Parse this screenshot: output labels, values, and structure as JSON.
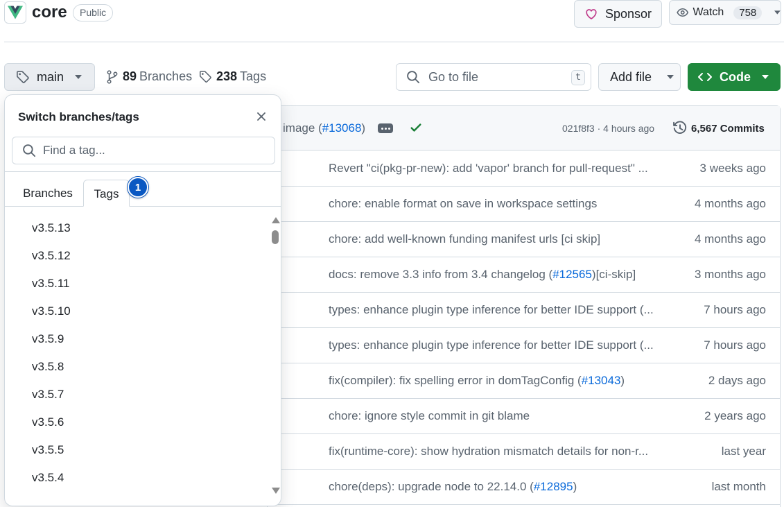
{
  "repo": {
    "name": "core",
    "visibility": "Public"
  },
  "header": {
    "sponsor_label": "Sponsor",
    "watch_label": "Watch",
    "watch_count": "758"
  },
  "toolbar": {
    "branch": "main",
    "branches_count": "89",
    "branches_label": "Branches",
    "tags_count": "238",
    "tags_label": "Tags",
    "go_to_file_placeholder": "Go to file",
    "go_to_file_key": "t",
    "add_file_label": "Add file",
    "code_label": "Code"
  },
  "latest_commit": {
    "message_prefix": "image (",
    "message_link": "#13068",
    "message_suffix": ")",
    "sha_time": "021f8f3 · 4 hours ago",
    "commits_label": "6,567 Commits"
  },
  "files": [
    {
      "msg": "Revert \"ci(pkg-pr-new): add 'vapor' branch for pull-request\" ...",
      "link": "",
      "after": "",
      "age": "3 weeks ago"
    },
    {
      "msg": "chore: enable format on save in workspace settings",
      "link": "",
      "after": "",
      "age": "4 months ago"
    },
    {
      "msg": "chore: add well-known funding manifest urls [ci skip]",
      "link": "",
      "after": "",
      "age": "4 months ago"
    },
    {
      "msg": "docs: remove 3.3 info from 3.4 changelog (",
      "link": "#12565",
      "after": ")[ci-skip]",
      "age": "3 months ago"
    },
    {
      "msg": "types: enhance plugin type inference for better IDE support (...",
      "link": "",
      "after": "",
      "age": "7 hours ago"
    },
    {
      "msg": "types: enhance plugin type inference for better IDE support (...",
      "link": "",
      "after": "",
      "age": "7 hours ago"
    },
    {
      "msg": "fix(compiler): fix spelling error in domTagConfig (",
      "link": "#13043",
      "after": ")",
      "age": "2 days ago"
    },
    {
      "msg": "chore: ignore style commit in git blame",
      "link": "",
      "after": "",
      "age": "2 years ago"
    },
    {
      "msg": "fix(runtime-core): show hydration mismatch details for non-r...",
      "link": "",
      "after": "",
      "age": "last year"
    },
    {
      "msg": "chore(deps): upgrade node to 22.14.0 (",
      "link": "#12895",
      "after": ")",
      "age": "last month"
    }
  ],
  "dropdown": {
    "title": "Switch branches/tags",
    "search_placeholder": "Find a tag...",
    "tab_branches": "Branches",
    "tab_tags": "Tags",
    "badge": "1",
    "tags": [
      "v3.5.13",
      "v3.5.12",
      "v3.5.11",
      "v3.5.10",
      "v3.5.9",
      "v3.5.8",
      "v3.5.7",
      "v3.5.6",
      "v3.5.5",
      "v3.5.4"
    ]
  },
  "colors": {
    "accent": "#0969da",
    "primary_button": "#1f883d",
    "sponsor_heart": "#bf3989",
    "check": "#1a7f37",
    "badge": "#0a58c2"
  },
  "icons": [
    "vue-logo-icon",
    "heart-icon",
    "eye-icon",
    "tag-icon",
    "branch-icon",
    "search-icon",
    "code-icon",
    "check-icon",
    "history-icon",
    "close-icon",
    "caret-down-icon"
  ]
}
